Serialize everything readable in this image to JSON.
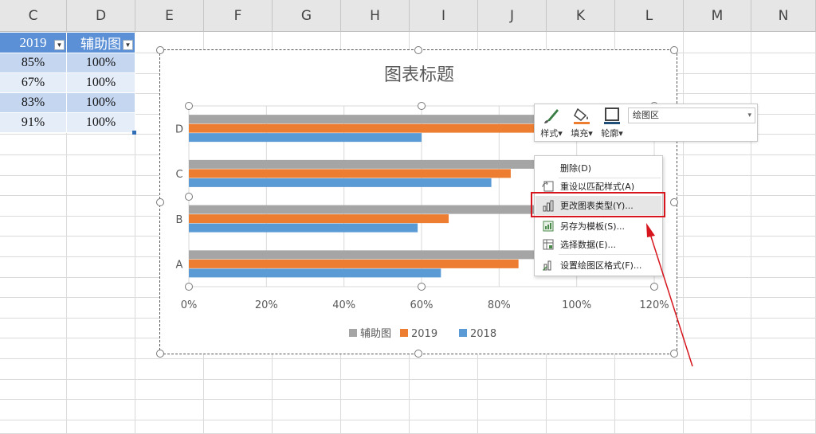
{
  "columns": [
    "C",
    "D",
    "E",
    "F",
    "G",
    "H",
    "I",
    "J",
    "K",
    "L",
    "M",
    "N"
  ],
  "table": {
    "headers": [
      "2019",
      "辅助图"
    ],
    "rows": [
      [
        "85%",
        "100%"
      ],
      [
        "67%",
        "100%"
      ],
      [
        "83%",
        "100%"
      ],
      [
        "91%",
        "100%"
      ]
    ]
  },
  "chart_data": {
    "type": "bar",
    "orientation": "horizontal",
    "title": "图表标题",
    "categories": [
      "A",
      "B",
      "C",
      "D"
    ],
    "series": [
      {
        "name": "辅助图",
        "color": "#a5a5a5",
        "values": [
          1.0,
          1.0,
          1.0,
          1.0
        ]
      },
      {
        "name": "2019",
        "color": "#ed7d31",
        "values": [
          0.85,
          0.67,
          0.83,
          0.91
        ]
      },
      {
        "name": "2018",
        "color": "#5b9bd5",
        "values": [
          0.65,
          0.59,
          0.78,
          0.6
        ]
      }
    ],
    "xlim": [
      0,
      1.2
    ],
    "ticks": [
      "0%",
      "20%",
      "40%",
      "60%",
      "80%",
      "100%",
      "120%"
    ],
    "grid": true,
    "legend": "bottom"
  },
  "toolbar": {
    "style_label": "样式",
    "fill_label": "填充",
    "outline_label": "轮廓",
    "area_value": "绘图区"
  },
  "context_menu": {
    "items": [
      {
        "label": "删除(D)",
        "icon": "none"
      },
      {
        "label": "重设以匹配样式(A)",
        "icon": "reset-style-icon"
      },
      {
        "label": "更改图表类型(Y)...",
        "icon": "chart-type-icon"
      },
      {
        "label": "另存为模板(S)...",
        "icon": "template-icon"
      },
      {
        "label": "选择数据(E)...",
        "icon": "select-data-icon"
      },
      {
        "label": "设置绘图区格式(F)...",
        "icon": "format-area-icon"
      }
    ]
  },
  "colors": {
    "highlight": "#d6151c",
    "header_blue": "#5b8fd6"
  }
}
